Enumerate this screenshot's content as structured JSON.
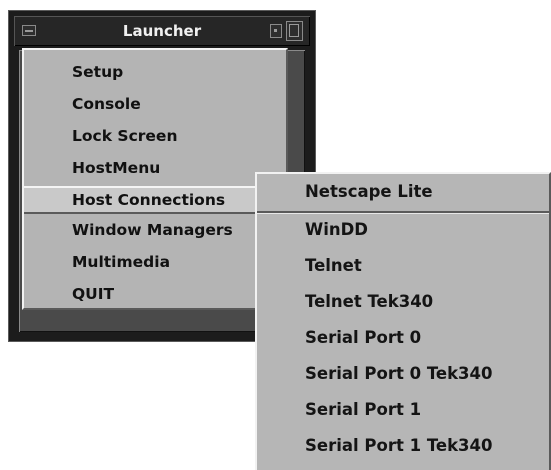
{
  "window": {
    "title": "Launcher"
  },
  "menu": {
    "items": [
      "Setup",
      "Console",
      "Lock Screen",
      "HostMenu",
      "Host Connections",
      "Window Managers",
      "Multimedia",
      "QUIT"
    ],
    "active_index": 4
  },
  "submenu": {
    "parent": "Host Connections",
    "items": [
      "Netscape Lite",
      "WinDD",
      "Telnet",
      "Telnet Tek340",
      "Serial Port 0",
      "Serial Port 0 Tek340",
      "Serial Port 1",
      "Serial Port 1 Tek340"
    ]
  },
  "icons": {
    "window_menu": "window-menu-icon",
    "minimize": "minimize-icon",
    "maximize": "maximize-icon"
  }
}
